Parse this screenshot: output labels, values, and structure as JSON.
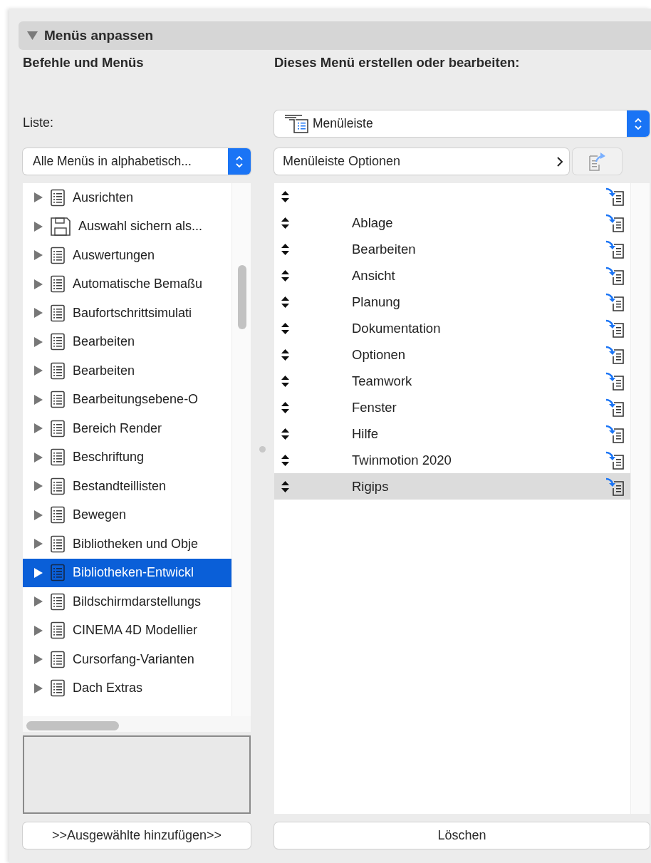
{
  "section": {
    "title": "Menüs anpassen",
    "expanded": true
  },
  "left": {
    "title": "Befehle und Menüs",
    "list_label": "Liste:",
    "dropdown": {
      "value": "Alle Menüs in alphabetisch..."
    },
    "items": [
      {
        "label": "Ausrichten",
        "kind": "menu",
        "selected": false
      },
      {
        "label": "Auswahl sichern als...",
        "kind": "save",
        "selected": false
      },
      {
        "label": "Auswertungen",
        "kind": "menu",
        "selected": false
      },
      {
        "label": "Automatische Bemaßu",
        "kind": "menu",
        "selected": false
      },
      {
        "label": "Baufortschrittsimulati",
        "kind": "menu",
        "selected": false
      },
      {
        "label": "Bearbeiten",
        "kind": "menu",
        "selected": false
      },
      {
        "label": "Bearbeiten",
        "kind": "menu",
        "selected": false
      },
      {
        "label": "Bearbeitungsebene-O",
        "kind": "menu",
        "selected": false
      },
      {
        "label": "Bereich Render",
        "kind": "menu",
        "selected": false
      },
      {
        "label": "Beschriftung",
        "kind": "menu",
        "selected": false
      },
      {
        "label": "Bestandteillisten",
        "kind": "menu",
        "selected": false
      },
      {
        "label": "Bewegen",
        "kind": "menu",
        "selected": false
      },
      {
        "label": "Bibliotheken und Obje",
        "kind": "menu",
        "selected": false
      },
      {
        "label": "Bibliotheken-Entwickl",
        "kind": "menu",
        "selected": true
      },
      {
        "label": "Bildschirmdarstellungs",
        "kind": "menu",
        "selected": false
      },
      {
        "label": "CINEMA 4D Modellier",
        "kind": "menu",
        "selected": false
      },
      {
        "label": "Cursorfang-Varianten",
        "kind": "menu",
        "selected": false
      },
      {
        "label": "Dach Extras",
        "kind": "menu",
        "selected": false
      }
    ],
    "add_button": ">>Ausgewählte hinzufügen>>"
  },
  "right": {
    "title": "Dieses Menü erstellen oder bearbeiten:",
    "dropdown": {
      "value": "Menüleiste"
    },
    "options_button": "Menüleiste Optionen",
    "items": [
      {
        "selected": false
      },
      {
        "label": "Ablage",
        "selected": false
      },
      {
        "label": "Bearbeiten",
        "selected": false
      },
      {
        "label": "Ansicht",
        "selected": false
      },
      {
        "label": "Planung",
        "selected": false
      },
      {
        "label": "Dokumentation",
        "selected": false
      },
      {
        "label": "Optionen",
        "selected": false
      },
      {
        "label": "Teamwork",
        "selected": false
      },
      {
        "label": "Fenster",
        "selected": false
      },
      {
        "label": "Hilfe",
        "selected": false
      },
      {
        "label": "Twinmotion 2020",
        "selected": false
      },
      {
        "label": "Rigips",
        "selected": true
      }
    ],
    "delete_button": "Löschen"
  }
}
